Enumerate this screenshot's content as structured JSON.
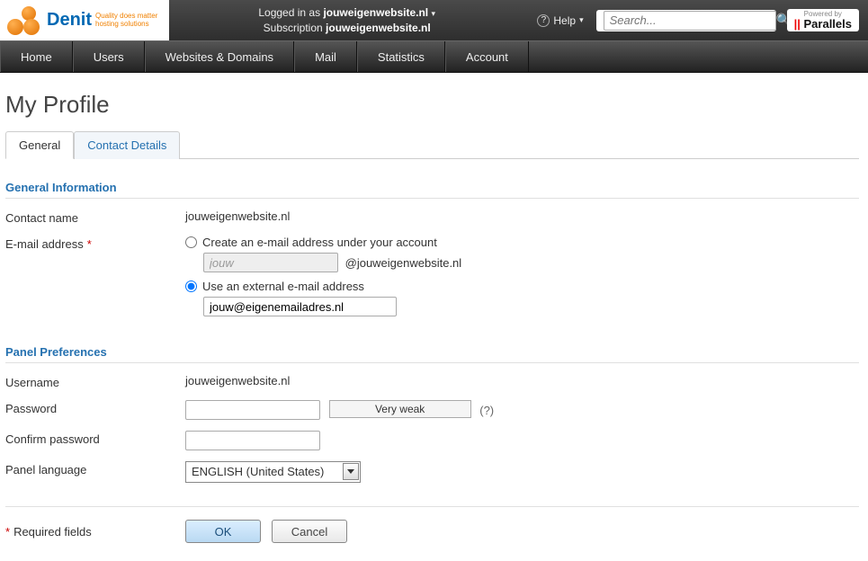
{
  "header": {
    "logo_text": "Denit",
    "logo_tag1": "Quality does matter",
    "logo_tag2": "hosting solutions",
    "logged_in_label": "Logged in as",
    "logged_in_value": "jouweigenwebsite.nl",
    "subscription_label": "Subscription",
    "subscription_value": "jouweigenwebsite.nl",
    "help_label": "Help",
    "search_placeholder": "Search...",
    "powered_by": "Powered by",
    "brand": "Parallels"
  },
  "nav": {
    "items": [
      "Home",
      "Users",
      "Websites & Domains",
      "Mail",
      "Statistics",
      "Account"
    ]
  },
  "page": {
    "title": "My Profile",
    "tabs": {
      "general": "General",
      "contact": "Contact Details"
    }
  },
  "section1": {
    "title": "General Information",
    "contact_label": "Contact name",
    "contact_value": "jouweigenwebsite.nl",
    "email_label": "E-mail address",
    "opt_create": "Create an e-mail address under your account",
    "opt_create_prefix": "jouw",
    "opt_create_domain": "@jouweigenwebsite.nl",
    "opt_external": "Use an external e-mail address",
    "external_value": "jouw@eigenemailadres.nl"
  },
  "section2": {
    "title": "Panel Preferences",
    "username_label": "Username",
    "username_value": "jouweigenwebsite.nl",
    "password_label": "Password",
    "strength_text": "Very weak",
    "help_q": "(?)",
    "confirm_label": "Confirm password",
    "lang_label": "Panel language",
    "lang_value": "ENGLISH (United States)"
  },
  "footer": {
    "required_note": "Required fields",
    "ok": "OK",
    "cancel": "Cancel"
  }
}
